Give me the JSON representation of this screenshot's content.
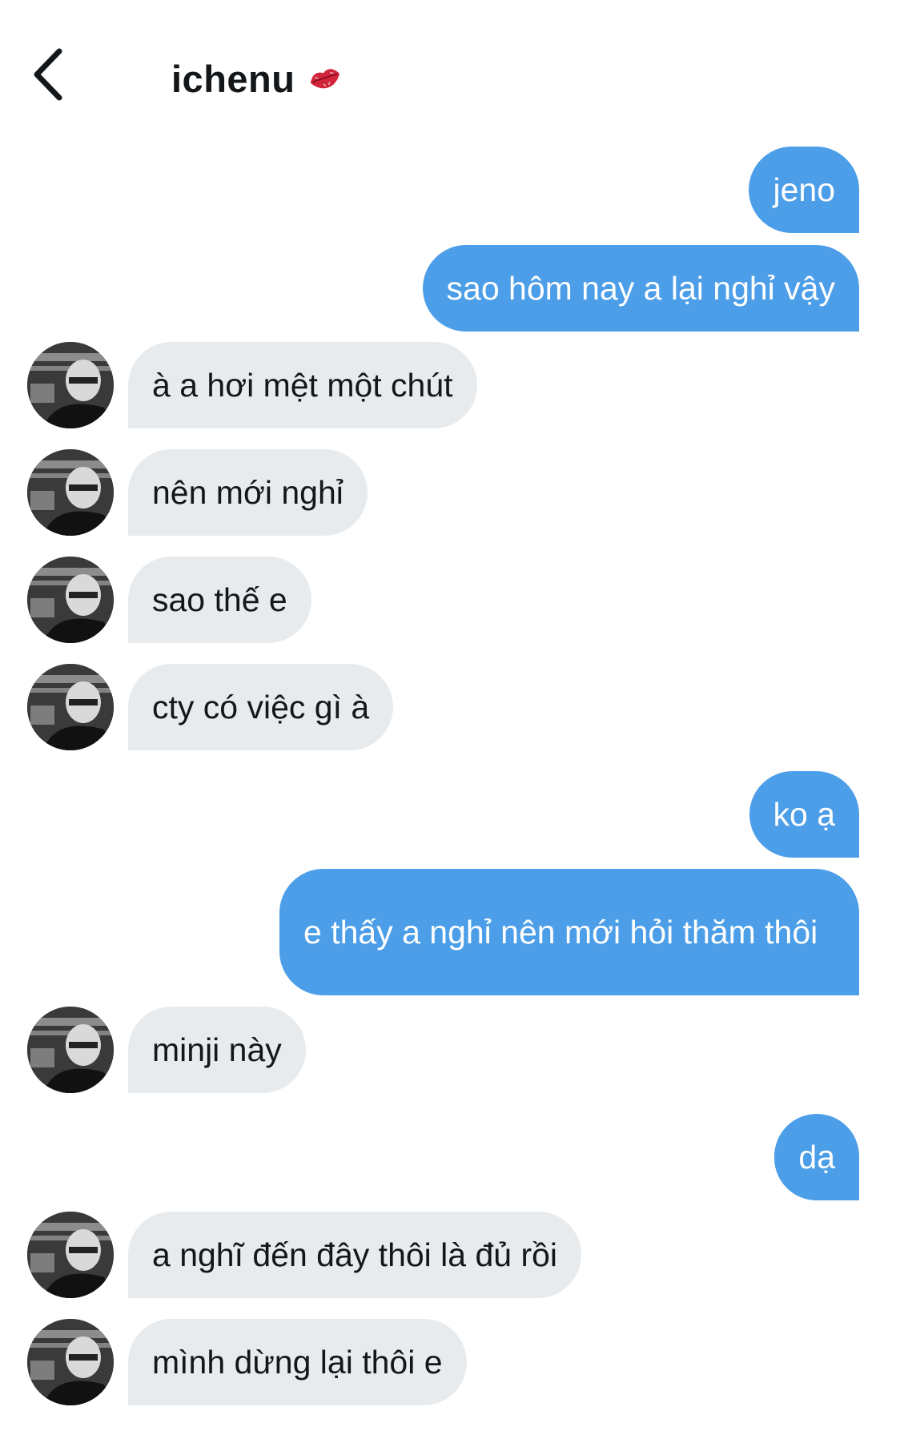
{
  "header": {
    "username": "ichenu",
    "badge_icon": "lips-icon"
  },
  "messages": [
    {
      "dir": "out",
      "text": "jeno"
    },
    {
      "dir": "out",
      "text": "sao hôm nay a lại nghỉ vậy"
    },
    {
      "dir": "in",
      "text": "à a hơi mệt một chút"
    },
    {
      "dir": "in",
      "text": "nên mới nghỉ"
    },
    {
      "dir": "in",
      "text": "sao thế e"
    },
    {
      "dir": "in",
      "text": "cty có việc gì à"
    },
    {
      "dir": "out",
      "text": "ko ạ"
    },
    {
      "dir": "out",
      "text": "e thấy a nghỉ nên mới hỏi thăm thôi"
    },
    {
      "dir": "in",
      "text": "minji này"
    },
    {
      "dir": "out",
      "text": "dạ"
    },
    {
      "dir": "in",
      "text": "a nghĩ đến đây thôi là đủ rồi"
    },
    {
      "dir": "in",
      "text": "mình dừng lại thôi e"
    }
  ],
  "colors": {
    "outgoing_bubble": "#4c9ee8",
    "incoming_bubble": "#e8ebee",
    "lips": "#d0243a"
  }
}
